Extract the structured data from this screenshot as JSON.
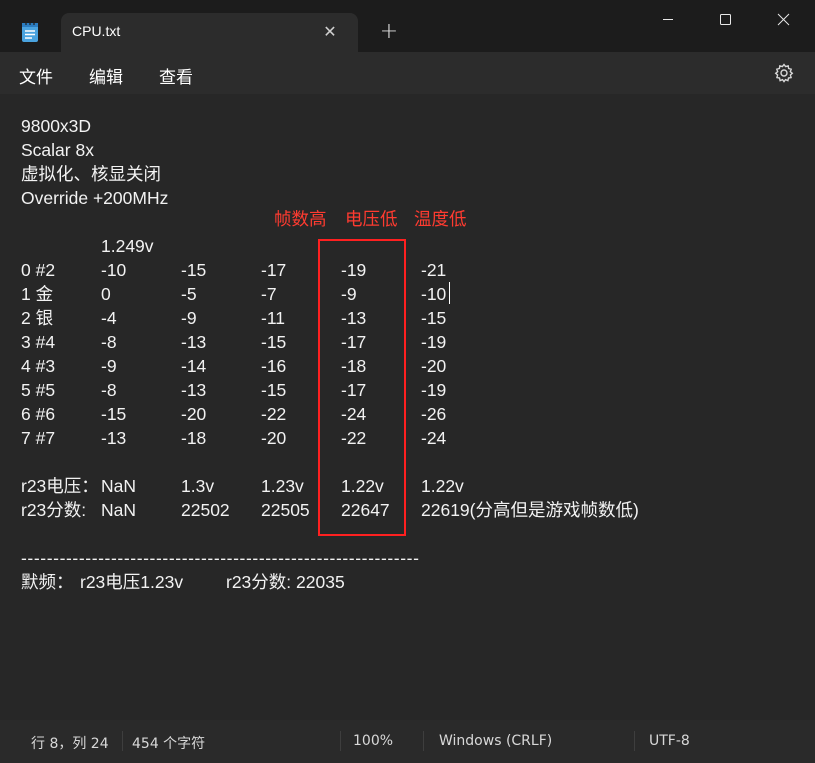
{
  "window": {
    "tab_title": "CPU.txt",
    "tab_close": "✕",
    "new_tab": "+",
    "icons": [
      "notepad-icon",
      "close-icon",
      "plus-icon",
      "minimize-icon",
      "maximize-icon",
      "close-icon",
      "gear-icon"
    ]
  },
  "menu": {
    "file": "文件",
    "edit": "编辑",
    "view": "查看"
  },
  "document": {
    "lines": [
      "9800x3D",
      "Scalar 8x",
      "虚拟化、核显关闭",
      "Override +200MHz"
    ],
    "annotations": [
      "帧数高",
      "电压低",
      "温度低"
    ],
    "voltage_header": "1.249v",
    "rows": [
      [
        "0 #2",
        "-10",
        "-15",
        "-17",
        "-19",
        "-21"
      ],
      [
        "1 金",
        "0",
        "-5",
        "-7",
        "-9",
        "-10"
      ],
      [
        "2 银",
        "-4",
        "-9",
        "-11",
        "-13",
        "-15"
      ],
      [
        "3 #4",
        "-8",
        "-13",
        "-15",
        "-17",
        "-19"
      ],
      [
        "4 #3",
        "-9",
        "-14",
        "-16",
        "-18",
        "-20"
      ],
      [
        "5 #5",
        "-8",
        "-13",
        "-15",
        "-17",
        "-19"
      ],
      [
        "6 #6",
        "-15",
        "-20",
        "-22",
        "-24",
        "-26"
      ],
      [
        "7 #7",
        "-13",
        "-18",
        "-20",
        "-22",
        "-24"
      ]
    ],
    "r23_voltage": [
      "r23电压：",
      "NaN",
      "1.3v",
      "1.23v",
      "1.22v",
      "1.22v"
    ],
    "r23_score": [
      "r23分数:",
      "NaN",
      "22502",
      "22505",
      "22647",
      "22619(分高但是游戏帧数低)"
    ],
    "divider": "--------------------------------------------------------------",
    "default_label": "默频：",
    "default_voltage": "r23电压1.23v",
    "default_score": "r23分数: 22035"
  },
  "status": {
    "position": "行 8，列 24",
    "chars": "454 个字符",
    "zoom": "100%",
    "line_ending": "Windows (CRLF)",
    "encoding": "UTF-8"
  }
}
